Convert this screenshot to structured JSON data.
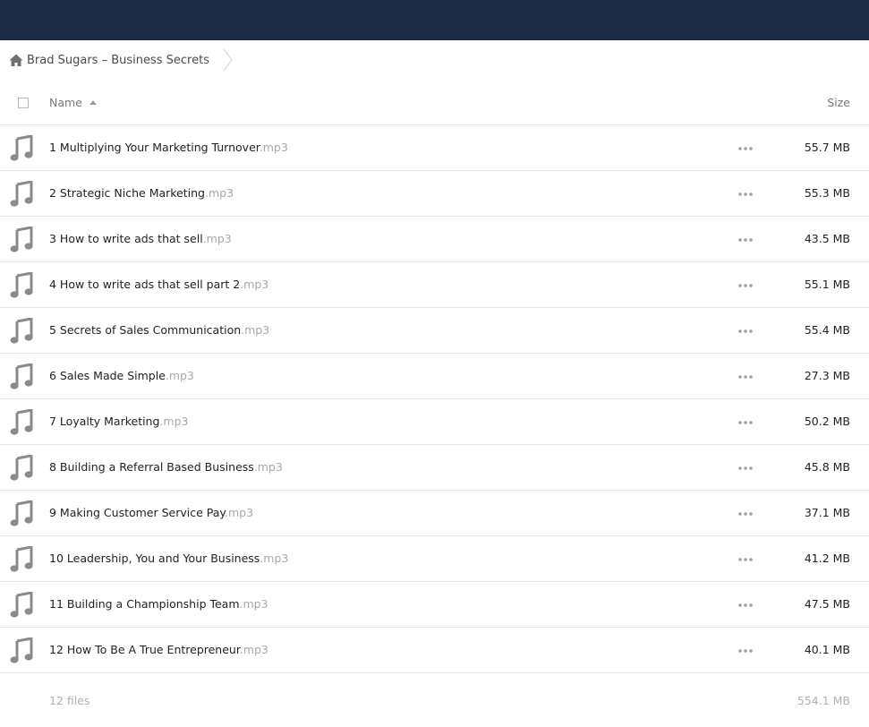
{
  "breadcrumb": {
    "folder_name": "Brad Sugars – Business Secrets"
  },
  "header": {
    "name_label": "Name",
    "size_label": "Size"
  },
  "files": [
    {
      "name": "1 Multiplying Your Marketing Turnover",
      "ext": ".mp3",
      "size": "55.7 MB"
    },
    {
      "name": "2 Strategic Niche Marketing",
      "ext": ".mp3",
      "size": "55.3 MB"
    },
    {
      "name": "3 How to write ads that sell",
      "ext": ".mp3",
      "size": "43.5 MB"
    },
    {
      "name": "4 How to write ads that sell part 2",
      "ext": ".mp3",
      "size": "55.1 MB"
    },
    {
      "name": "5 Secrets of Sales Communication",
      "ext": ".mp3",
      "size": "55.4 MB"
    },
    {
      "name": "6 Sales Made Simple",
      "ext": ".mp3",
      "size": "27.3 MB"
    },
    {
      "name": "7 Loyalty Marketing",
      "ext": ".mp3",
      "size": "50.2 MB"
    },
    {
      "name": "8 Building a Referral Based Business",
      "ext": ".mp3",
      "size": "45.8 MB"
    },
    {
      "name": "9 Making Customer Service Pay",
      "ext": ".mp3",
      "size": "37.1 MB"
    },
    {
      "name": "10 Leadership, You and Your Business",
      "ext": ".mp3",
      "size": "41.2 MB"
    },
    {
      "name": "11 Building a Championship Team",
      "ext": ".mp3",
      "size": "47.5 MB"
    },
    {
      "name": "12 How To Be A True Entrepreneur",
      "ext": ".mp3",
      "size": "40.1 MB"
    }
  ],
  "footer": {
    "count": "12 files",
    "total_size": "554.1 MB"
  },
  "colors": {
    "topbar": "#1d2b44",
    "icon_gray": "#8a8a8a",
    "muted_text": "#a8a8a8"
  },
  "icons": {
    "home": "home-icon",
    "file": "music-note-icon",
    "more": "more-options-icon",
    "sort": "sort-ascending-icon"
  }
}
